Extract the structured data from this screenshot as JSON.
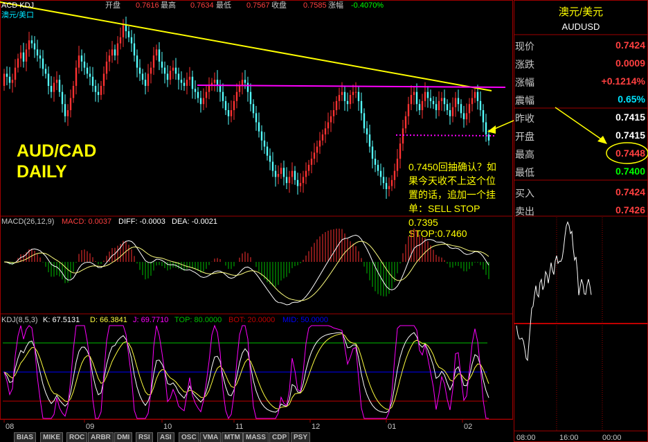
{
  "header": {
    "symbol": "ACD KDJ",
    "sub": "澳元/美口",
    "open_label": "开盘",
    "open": "0.7616",
    "high_label": "最高",
    "high": "0.7634",
    "low_label": "最低",
    "low": "0.7567",
    "close_label": "收盘",
    "close": "0.7585",
    "change_label": "涨幅",
    "change": "-0.4070%"
  },
  "overlay": {
    "title1": "AUD/CAD",
    "title2": "DAILY",
    "note1": "0.7450回抽确认？如",
    "note2": "果今天收不上这个位",
    "note3": "置的话，追加一个挂",
    "note4": "单：SELL STOP",
    "note5": "0.7395",
    "note6": "STOP:0.7460"
  },
  "macd": {
    "label": "MACD(26,12,9)",
    "macd_text": "MACD: 0.0037",
    "diff_text": "DIFF: -0.0003",
    "dea_text": "DEA: -0.0021"
  },
  "kdj": {
    "label": "KDJ(8,5,3)",
    "k_text": "K: 67.5131",
    "d_text": "D: 66.3841",
    "j_text": "J: 69.7710",
    "top_text": "TOP: 80.0000",
    "bot_text": "BOT: 20.0000",
    "mid_text": "MID: 50.0000"
  },
  "x_axis": [
    "08",
    "09",
    "10",
    "11",
    "12",
    "01",
    "02"
  ],
  "quote": {
    "title": "澳元/美元",
    "code": "AUDUSD",
    "rows": [
      {
        "label": "现价",
        "value": "0.7424",
        "color": "#ff4040"
      },
      {
        "label": "涨跌",
        "value": "0.0009",
        "color": "#ff4040"
      },
      {
        "label": "涨幅",
        "value": "+0.1214%",
        "color": "#ff4040"
      },
      {
        "label": "震幅",
        "value": "0.65%",
        "color": "#00e5ff"
      },
      {
        "label": "昨收",
        "value": "0.7415",
        "color": "#ffffff"
      },
      {
        "label": "开盘",
        "value": "0.7415",
        "color": "#ffffff"
      },
      {
        "label": "最高",
        "value": "0.7448",
        "color": "#ff4040"
      },
      {
        "label": "最低",
        "value": "0.7400",
        "color": "#00ff00"
      },
      {
        "label": "买入",
        "value": "0.7424",
        "color": "#ff4040"
      },
      {
        "label": "卖出",
        "value": "0.7426",
        "color": "#ff4040"
      }
    ],
    "time_axis": [
      "08:00",
      "16:00",
      "00:00"
    ]
  },
  "tabs": [
    "BIAS",
    "MIKE",
    "ROC",
    "ARBR",
    "DMI",
    "RSI",
    "ASI",
    "OSC",
    "VMA",
    "MTM",
    "MASS",
    "CDP",
    "PSY"
  ],
  "colors": {
    "up": "#ff3232",
    "down": "#54ffff",
    "trend": "#ffff00",
    "resistance": "#ff00ff",
    "grid": "#a00000",
    "kdj_top": "#00c000",
    "kdj_bot": "#c00000",
    "kdj_mid": "#0000ff"
  },
  "chart_data": [
    {
      "type": "candlestick",
      "title": "AUD/CAD DAILY",
      "x_ticks": [
        "08",
        "09",
        "10",
        "11",
        "12",
        "01",
        "02"
      ],
      "ylim": [
        0.736,
        0.77
      ],
      "open": [
        0.757,
        0.759,
        0.7585,
        0.7575,
        0.758,
        0.76,
        0.7615,
        0.7625,
        0.761,
        0.763,
        0.7645,
        0.764,
        0.763,
        0.762,
        0.7615,
        0.7598,
        0.759,
        0.757,
        0.756,
        0.7575,
        0.758,
        0.756,
        0.754,
        0.752,
        0.753,
        0.755,
        0.757,
        0.76,
        0.762,
        0.761,
        0.76,
        0.759,
        0.7585,
        0.757,
        0.756,
        0.7555,
        0.757,
        0.759,
        0.761,
        0.762,
        0.763,
        0.762,
        0.764,
        0.765,
        0.767,
        0.766,
        0.765,
        0.764,
        0.762,
        0.76,
        0.759,
        0.758,
        0.757,
        0.759,
        0.76,
        0.762,
        0.763,
        0.761,
        0.76,
        0.759,
        0.758,
        0.7595,
        0.76,
        0.759,
        0.758,
        0.7575,
        0.757,
        0.758,
        0.7585,
        0.7565,
        0.756,
        0.755,
        0.754,
        0.755,
        0.756,
        0.757,
        0.7575,
        0.758,
        0.757,
        0.756,
        0.7545,
        0.753,
        0.752,
        0.753,
        0.7545,
        0.756,
        0.757,
        0.758,
        0.7575,
        0.756,
        0.754,
        0.7525,
        0.751,
        0.7495,
        0.748,
        0.747,
        0.7455,
        0.7445,
        0.743,
        0.742,
        0.7425,
        0.7435,
        0.742,
        0.741,
        0.742,
        0.743,
        0.7415,
        0.7405,
        0.741,
        0.742,
        0.743,
        0.744,
        0.745,
        0.746,
        0.747,
        0.748,
        0.749,
        0.75,
        0.751,
        0.752,
        0.753,
        0.7545,
        0.7555,
        0.756,
        0.7545,
        0.754,
        0.7555,
        0.756,
        0.756,
        0.7545,
        0.7525,
        0.75,
        0.749,
        0.747,
        0.745,
        0.744,
        0.743,
        0.742,
        0.741,
        0.74,
        0.7405,
        0.7415,
        0.743,
        0.745,
        0.7475,
        0.75,
        0.752,
        0.754,
        0.7555,
        0.756,
        0.754,
        0.753,
        0.7545,
        0.756,
        0.755,
        0.7545,
        0.754,
        0.753,
        0.7545,
        0.755,
        0.754,
        0.753,
        0.752,
        0.7535,
        0.755,
        0.754,
        0.7525,
        0.7515,
        0.7525,
        0.754,
        0.755,
        0.756,
        0.7545,
        0.753,
        0.751,
        0.749
      ],
      "close": [
        0.759,
        0.7585,
        0.7575,
        0.758,
        0.76,
        0.7615,
        0.7625,
        0.761,
        0.763,
        0.7645,
        0.764,
        0.763,
        0.762,
        0.7615,
        0.7598,
        0.759,
        0.757,
        0.756,
        0.7575,
        0.758,
        0.756,
        0.754,
        0.752,
        0.753,
        0.755,
        0.757,
        0.76,
        0.762,
        0.761,
        0.76,
        0.759,
        0.7585,
        0.757,
        0.756,
        0.7555,
        0.757,
        0.759,
        0.761,
        0.762,
        0.763,
        0.762,
        0.764,
        0.765,
        0.767,
        0.766,
        0.765,
        0.764,
        0.762,
        0.76,
        0.759,
        0.758,
        0.757,
        0.759,
        0.76,
        0.762,
        0.763,
        0.761,
        0.76,
        0.759,
        0.758,
        0.7595,
        0.76,
        0.759,
        0.758,
        0.7575,
        0.757,
        0.758,
        0.7585,
        0.7565,
        0.756,
        0.755,
        0.754,
        0.755,
        0.756,
        0.757,
        0.7575,
        0.758,
        0.757,
        0.756,
        0.7545,
        0.753,
        0.752,
        0.753,
        0.7545,
        0.756,
        0.757,
        0.758,
        0.7575,
        0.756,
        0.754,
        0.7525,
        0.751,
        0.7495,
        0.748,
        0.747,
        0.7455,
        0.7445,
        0.743,
        0.742,
        0.7425,
        0.7435,
        0.742,
        0.741,
        0.742,
        0.743,
        0.7415,
        0.7405,
        0.741,
        0.742,
        0.743,
        0.744,
        0.745,
        0.746,
        0.747,
        0.748,
        0.749,
        0.75,
        0.751,
        0.752,
        0.753,
        0.7545,
        0.7555,
        0.756,
        0.7545,
        0.754,
        0.7555,
        0.756,
        0.756,
        0.7545,
        0.7525,
        0.75,
        0.749,
        0.747,
        0.745,
        0.744,
        0.743,
        0.742,
        0.741,
        0.74,
        0.7405,
        0.7415,
        0.743,
        0.745,
        0.7475,
        0.75,
        0.752,
        0.754,
        0.7555,
        0.756,
        0.754,
        0.753,
        0.7545,
        0.756,
        0.755,
        0.7545,
        0.754,
        0.753,
        0.7545,
        0.755,
        0.754,
        0.753,
        0.752,
        0.7535,
        0.755,
        0.754,
        0.7525,
        0.7515,
        0.7525,
        0.754,
        0.755,
        0.756,
        0.7545,
        0.753,
        0.751,
        0.749,
        0.748
      ],
      "trendlines": [
        {
          "name": "down-trend",
          "points": [
            [
              0.77,
              0
            ],
            [
              0.7565,
              178
            ]
          ],
          "color": "#ffff00"
        },
        {
          "name": "resistance",
          "level": 0.7556,
          "color": "#ff00ff"
        },
        {
          "name": "support-dotted",
          "level": 0.7498,
          "color": "#ff00ff"
        }
      ]
    },
    {
      "type": "bar+line",
      "title": "MACD(26,12,9)",
      "series": [
        {
          "name": "MACD",
          "last": 0.0037
        },
        {
          "name": "DIFF",
          "last": -0.0003
        },
        {
          "name": "DEA",
          "last": -0.0021
        }
      ]
    },
    {
      "type": "line",
      "title": "KDJ(8,5,3)",
      "ylim": [
        0,
        100
      ],
      "series": [
        {
          "name": "K",
          "last": 67.5131
        },
        {
          "name": "D",
          "last": 66.3841
        },
        {
          "name": "J",
          "last": 69.771
        }
      ],
      "levels": {
        "TOP": 80,
        "BOT": 20,
        "MID": 50
      }
    },
    {
      "type": "line",
      "title": "AUDUSD intraday",
      "x_ticks": [
        "08:00",
        "16:00",
        "00:00"
      ]
    }
  ]
}
